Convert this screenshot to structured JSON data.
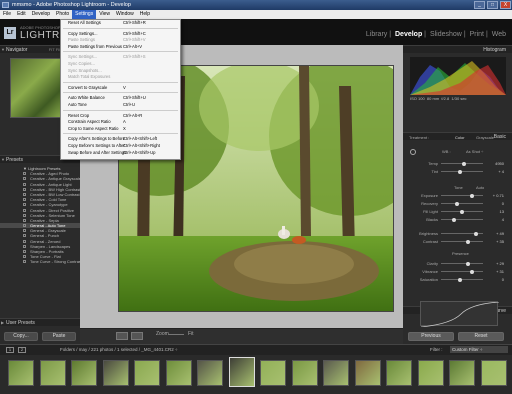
{
  "window": {
    "title": "mmsmo - Adobe Photoshop Lightroom - Develop",
    "min": "_",
    "max": "□",
    "close": "X"
  },
  "menubar": [
    "File",
    "Edit",
    "Develop",
    "Photo",
    "Settings",
    "View",
    "Window",
    "Help"
  ],
  "identity": {
    "adobe": "ADOBE PHOTOSHOP",
    "product": "LIGHTROOM",
    "logo": "Lr"
  },
  "modules": [
    "Library",
    "Develop",
    "Slideshow",
    "Print",
    "Web"
  ],
  "left": {
    "navigator": "Navigator",
    "navigator_sub": "FIT  FILL  1:1  3:1",
    "presets": "Presets",
    "user_presets": "User Presets",
    "copy": "Copy...",
    "paste": "Paste"
  },
  "presets": [
    {
      "label": "Lightroom Presets",
      "folder": true
    },
    {
      "label": "Creative - Aged Photo"
    },
    {
      "label": "Creative - Antique Grayscale"
    },
    {
      "label": "Creative - Antique Light"
    },
    {
      "label": "Creative - BW High Contrast"
    },
    {
      "label": "Creative - BW Low Contrast"
    },
    {
      "label": "Creative - Cold Tone"
    },
    {
      "label": "Creative - Cyanotype"
    },
    {
      "label": "Creative - Direct Positive"
    },
    {
      "label": "Creative - Selenium Tone"
    },
    {
      "label": "Creative - Sepia"
    },
    {
      "label": "General - Auto Tone"
    },
    {
      "label": "General - Grayscale"
    },
    {
      "label": "General - Punch"
    },
    {
      "label": "General - Zeroed"
    },
    {
      "label": "Sharpen - Landscapes"
    },
    {
      "label": "Sharpen - Portraits"
    },
    {
      "label": "Tone Curve - Flat"
    },
    {
      "label": "Tone Curve - Strong Contrast"
    }
  ],
  "menu": [
    {
      "label": "Reset All Settings",
      "shortcut": "Ctrl+Shift+R"
    },
    "sep",
    {
      "label": "Copy Settings...",
      "shortcut": "Ctrl+Shift+C"
    },
    {
      "label": "Paste Settings",
      "shortcut": "Ctrl+Shift+V",
      "disabled": true
    },
    {
      "label": "Paste Settings from Previous",
      "shortcut": "Ctrl+Alt+V"
    },
    "sep",
    {
      "label": "Sync Settings...",
      "shortcut": "Ctrl+Shift+S",
      "disabled": true
    },
    {
      "label": "Sync Copies...",
      "disabled": true
    },
    {
      "label": "Sync Snapshots...",
      "disabled": true
    },
    {
      "label": "Match Total Exposures",
      "disabled": true
    },
    "sep",
    {
      "label": "Convert to Grayscale",
      "shortcut": "V"
    },
    "sep",
    {
      "label": "Auto White Balance",
      "shortcut": "Ctrl+Shift+U"
    },
    {
      "label": "Auto Tone",
      "shortcut": "Ctrl+U"
    },
    "sep",
    {
      "label": "Reset Crop",
      "shortcut": "Ctrl+Alt+R"
    },
    {
      "label": "Constrain Aspect Ratio",
      "shortcut": "A"
    },
    {
      "label": "Crop to Same Aspect Ratio",
      "shortcut": "X"
    },
    "sep",
    {
      "label": "Copy After's Settings to Before",
      "shortcut": "Ctrl+Alt+Shift+Left"
    },
    {
      "label": "Copy Before's Settings to After",
      "shortcut": "Ctrl+Alt+Shift+Right"
    },
    {
      "label": "Swap Before and After Settings",
      "shortcut": "Ctrl+Alt+Shift+Up"
    }
  ],
  "histogram": {
    "title": "Histogram",
    "iso": "ISO 100",
    "focal": "80 mm",
    "aperture": "f/2.8",
    "shutter": "1/30 sec"
  },
  "basic": {
    "title": "Basic",
    "treatment": "Treatment :",
    "color": "Color",
    "grayscale": "Grayscale",
    "wb_label": "WB :",
    "wb_value": "As Shot ÷"
  },
  "sliders": [
    {
      "label": "Temp",
      "value": "4950"
    },
    {
      "label": "Tint",
      "value": "+ 4"
    },
    {
      "label": "Exposure",
      "value": "+ 0.71"
    },
    {
      "label": "Recovery",
      "value": "0"
    },
    {
      "label": "Fill Light",
      "value": "13"
    },
    {
      "label": "Blacks",
      "value": "4"
    },
    {
      "label": "Brightness",
      "value": "+ 49"
    },
    {
      "label": "Contrast",
      "value": "+ 35"
    },
    {
      "label": "Clarity",
      "value": "+ 29"
    },
    {
      "label": "Vibrance",
      "value": "+ 31"
    },
    {
      "label": "Saturation",
      "value": "0"
    }
  ],
  "tone": {
    "label": "Tone",
    "auto": "Auto",
    "presence": "Presence"
  },
  "tone_curve": {
    "title": "Tone Curve"
  },
  "right_btns": {
    "previous": "Previous",
    "reset": "Reset"
  },
  "toolbar": {
    "zoom": "Zoom",
    "zoom_val": "Fit"
  },
  "filmbar": {
    "pages": [
      "1",
      "2"
    ],
    "path": "Folders / may / 221 photos / 1 selected / _MG_4401.CR2 ÷",
    "filter": "Filter :",
    "filter_value": "Custom Filter ÷"
  },
  "colors": {
    "selected_menu": "#3163c5",
    "panel": "#2b2b2b"
  }
}
